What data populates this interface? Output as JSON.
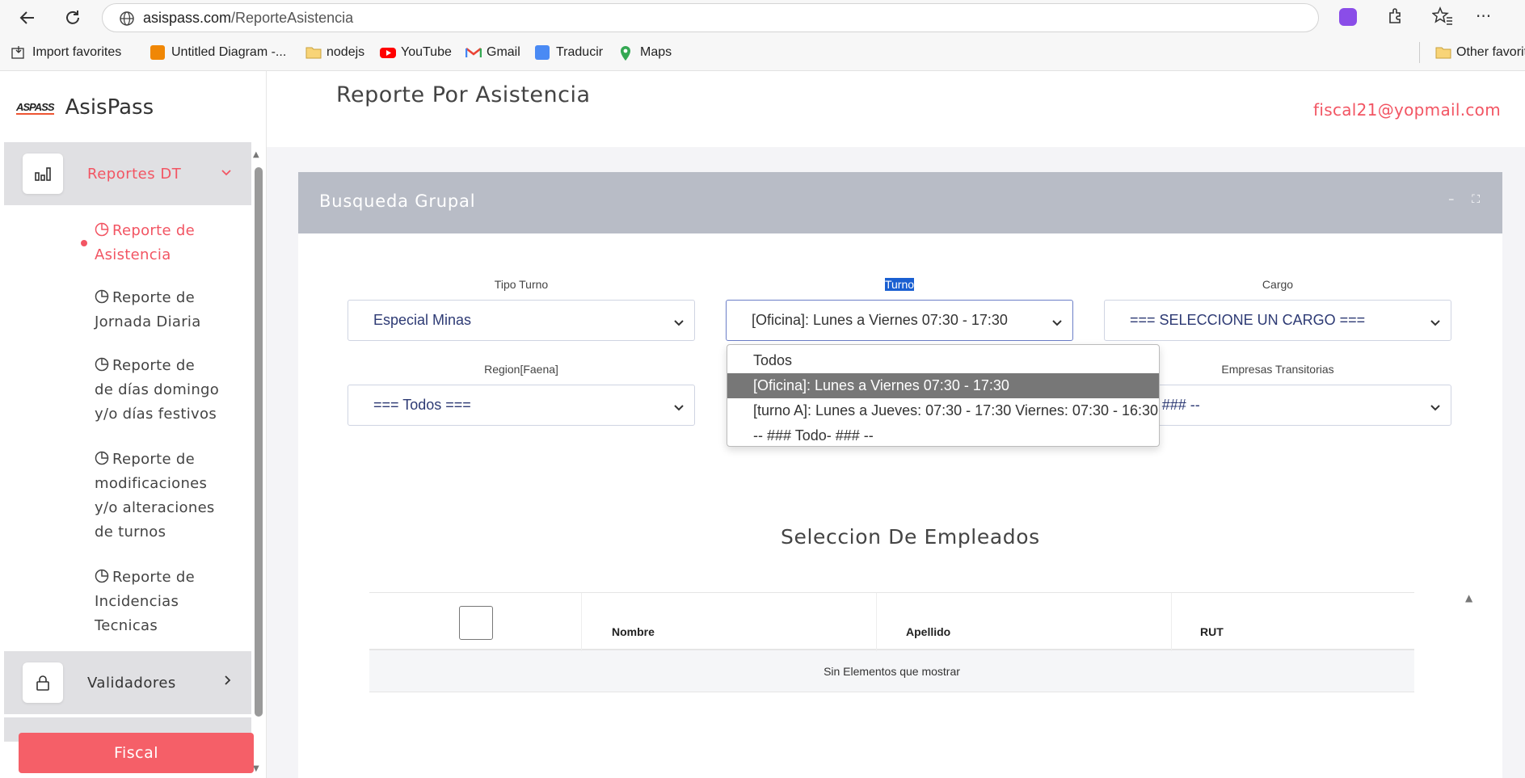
{
  "browser": {
    "url_host": "asispass.com",
    "url_path": "/ReporteAsistencia",
    "bookmarks": [
      "Import favorites",
      "Untitled Diagram -...",
      "nodejs",
      "YouTube",
      "Gmail",
      "Traducir",
      "Maps",
      "Other favorit"
    ]
  },
  "sidebar": {
    "brand_logo": "ASPASS",
    "brand_name": "AsisPass",
    "group_reportes": "Reportes DT",
    "items": [
      {
        "line1": "Reporte de",
        "rest": [
          "Asistencia"
        ]
      },
      {
        "line1": "Reporte de",
        "rest": [
          "Jornada Diaria"
        ]
      },
      {
        "line1": "Reporte de",
        "rest": [
          "de días domingo",
          "y/o días festivos"
        ]
      },
      {
        "line1": "Reporte de",
        "rest": [
          "modificaciones",
          "y/o alteraciones",
          "de turnos"
        ]
      },
      {
        "line1": "Reporte de",
        "rest": [
          "Incidencias",
          "Tecnicas"
        ]
      }
    ],
    "group_validadores": "Validadores",
    "fiscal_button": "Fiscal"
  },
  "header": {
    "title": "Reporte Por Asistencia",
    "user_email": "fiscal21@yopmail.com"
  },
  "panel": {
    "title": "Busqueda Grupal",
    "minimize": "–",
    "expand": "⛶",
    "fields": {
      "tipo_turno": {
        "label": "Tipo Turno",
        "value": "Especial Minas"
      },
      "turno": {
        "label": "Turno",
        "value": "[Oficina]: Lunes a Viernes 07:30 - 17:30"
      },
      "cargo": {
        "label": "Cargo",
        "value": "=== SELECCIONE UN CARGO ==="
      },
      "region": {
        "label": "Region[Faena]",
        "value": "=== Todos ==="
      },
      "empresas": {
        "label": "Empresas Transitorias",
        "value": "# Todo- ### --"
      }
    },
    "turno_options": [
      "Todos",
      "[Oficina]: Lunes a Viernes 07:30 - 17:30",
      "[turno A]: Lunes a Jueves: 07:30 - 17:30 Viernes: 07:30 - 16:30",
      "-- ### Todo- ### --"
    ],
    "selected_option_index": 1
  },
  "employees": {
    "title": "Seleccion De Empleados",
    "columns": [
      "Nombre",
      "Apellido",
      "RUT"
    ],
    "empty_message": "Sin Elementos que mostrar"
  }
}
